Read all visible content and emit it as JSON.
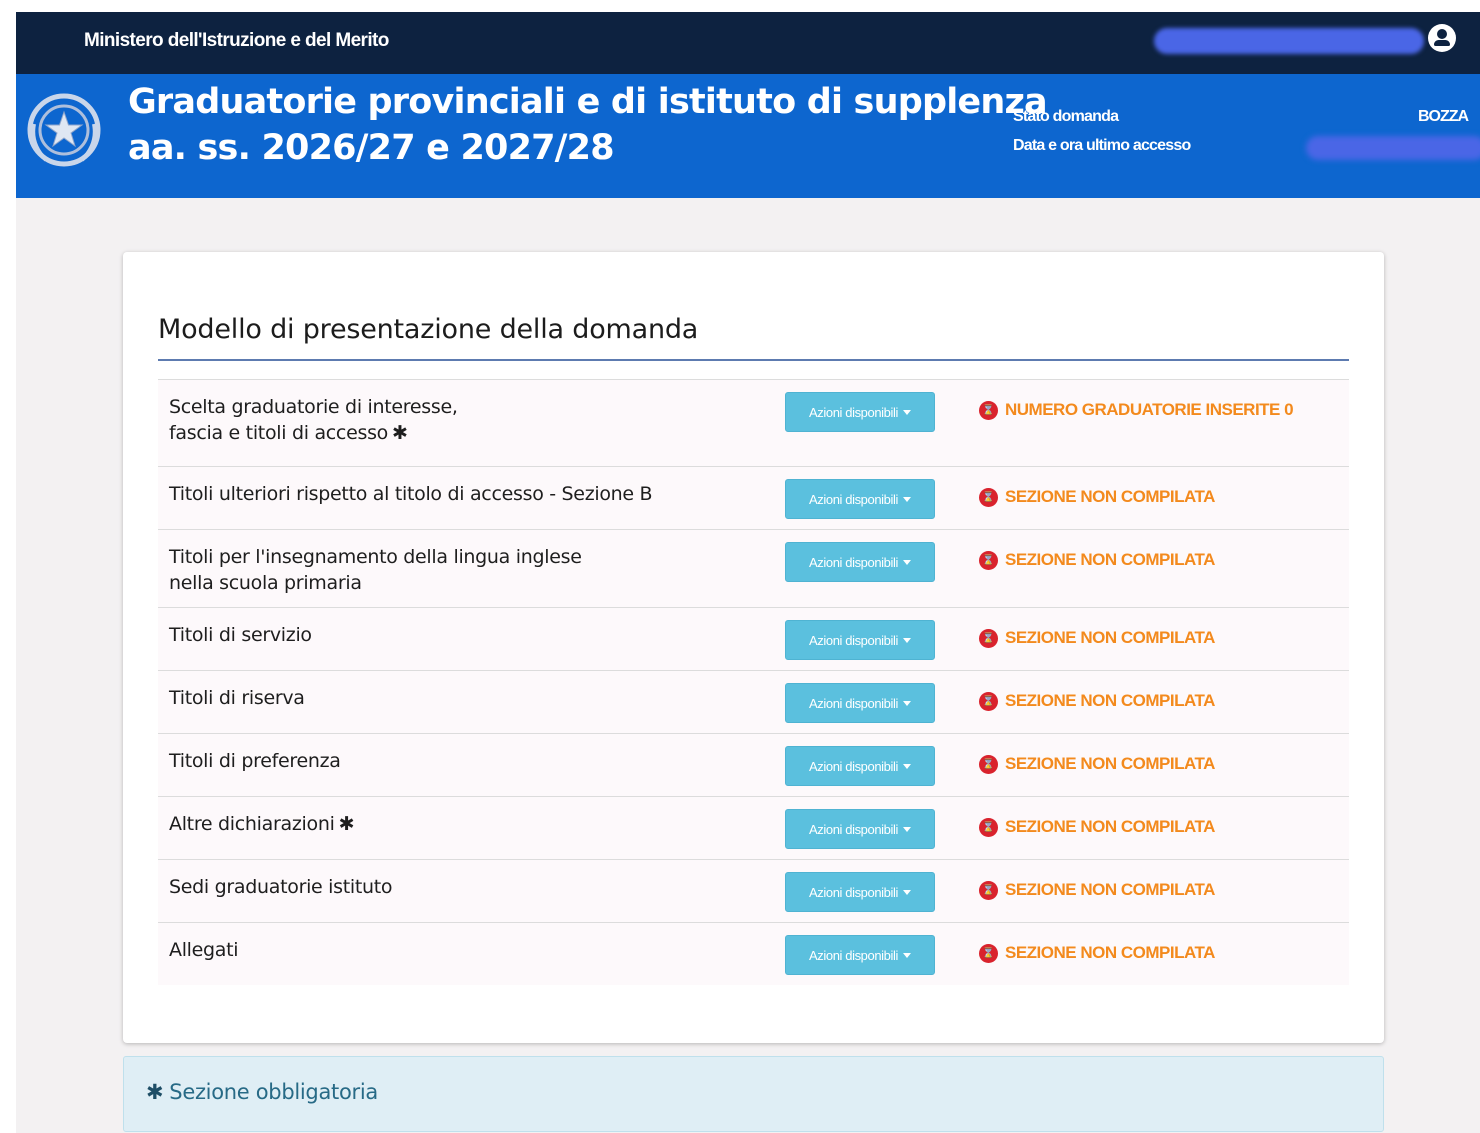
{
  "topbar": {
    "ministry": "Ministero dell'Istruzione e del Merito",
    "user_icon": "user-circle-icon"
  },
  "header": {
    "title_line1": "Graduatorie provinciali e di istituto di supplenza",
    "title_line2": "aa. ss. 2026/27 e 2027/28",
    "stato_label": "Stato domanda",
    "stato_value": "BOZZA",
    "accesso_label": "Data e ora ultimo accesso"
  },
  "form": {
    "title": "Modello di presentazione della domanda",
    "actions_label": "Azioni disponibili",
    "status_icon": "error-circle-icon",
    "sections": [
      {
        "label_line1": "Scelta graduatorie di interesse,",
        "label_line2": "fascia e titoli di accesso",
        "required_mark": "✱",
        "status": "NUMERO GRADUATORIE INSERITE 0"
      },
      {
        "label_line1": "Titoli ulteriori rispetto al titolo di accesso - Sezione B",
        "label_line2": "",
        "required_mark": "",
        "status": "SEZIONE NON COMPILATA"
      },
      {
        "label_line1": "Titoli per l'insegnamento della lingua inglese",
        "label_line2": "nella scuola primaria",
        "required_mark": "",
        "status": "SEZIONE NON COMPILATA"
      },
      {
        "label_line1": "Titoli di servizio",
        "label_line2": "",
        "required_mark": "",
        "status": "SEZIONE NON COMPILATA"
      },
      {
        "label_line1": "Titoli di riserva",
        "label_line2": "",
        "required_mark": "",
        "status": "SEZIONE NON COMPILATA"
      },
      {
        "label_line1": "Titoli di preferenza",
        "label_line2": "",
        "required_mark": "",
        "status": "SEZIONE NON COMPILATA"
      },
      {
        "label_line1": "Altre dichiarazioni",
        "label_line2": "",
        "required_mark": "✱",
        "status": "SEZIONE NON COMPILATA"
      },
      {
        "label_line1": "Sedi graduatorie istituto",
        "label_line2": "",
        "required_mark": "",
        "status": "SEZIONE NON COMPILATA"
      },
      {
        "label_line1": "Allegati",
        "label_line2": "",
        "required_mark": "",
        "status": "SEZIONE NON COMPILATA"
      }
    ]
  },
  "info": {
    "mark": "✱",
    "text": "Sezione obbligatoria"
  },
  "colors": {
    "topbar": "#0d2240",
    "header": "#0d66cf",
    "button": "#5bc0de",
    "status_text": "#f38a1d",
    "status_icon": "#d9232d"
  }
}
